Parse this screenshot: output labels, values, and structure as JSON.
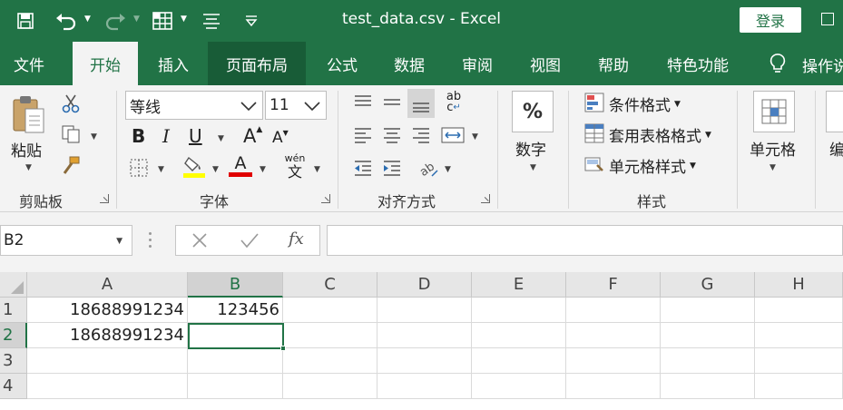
{
  "window": {
    "title": "test_data.csv  -  Excel",
    "login_label": "登录"
  },
  "menu": {
    "tabs": [
      "文件",
      "开始",
      "插入",
      "页面布局",
      "公式",
      "数据",
      "审阅",
      "视图",
      "帮助",
      "特色功能"
    ],
    "active_tab": "开始",
    "tell_me": "操作说"
  },
  "ribbon": {
    "clipboard": {
      "paste_label": "粘贴",
      "group_label": "剪贴板"
    },
    "font": {
      "font_name": "等线",
      "font_size": "11",
      "bold": "B",
      "italic": "I",
      "underline": "U",
      "grow": "A",
      "shrink": "A",
      "font_color_letter": "A",
      "phonetic_top": "wén",
      "phonetic_bottom": "文",
      "group_label": "字体"
    },
    "alignment": {
      "group_label": "对齐方式",
      "wrap_top": "ab",
      "wrap_bottom": "c"
    },
    "number": {
      "symbol": "%",
      "label": "数字"
    },
    "styles": {
      "conditional": "条件格式",
      "table_format": "套用表格格式",
      "cell_styles": "单元格样式",
      "group_label": "样式"
    },
    "cells": {
      "label": "单元格"
    },
    "editing": {
      "label": "编"
    }
  },
  "formula_bar": {
    "name_box": "B2",
    "fx": "fx",
    "formula": ""
  },
  "sheet": {
    "columns": [
      "A",
      "B",
      "C",
      "D",
      "E",
      "F",
      "G",
      "H"
    ],
    "rows": [
      "1",
      "2",
      "3",
      "4"
    ],
    "cells": {
      "A1": "18688991234",
      "B1": "123456",
      "A2": "18688991234"
    },
    "selected_cell": "B2"
  },
  "colors": {
    "accent": "#217346",
    "accent_dark": "#185c37",
    "ribbon_bg": "#f3f3f3",
    "font_color_bar": "#e00000",
    "highlight_bar": "#ffff00"
  }
}
